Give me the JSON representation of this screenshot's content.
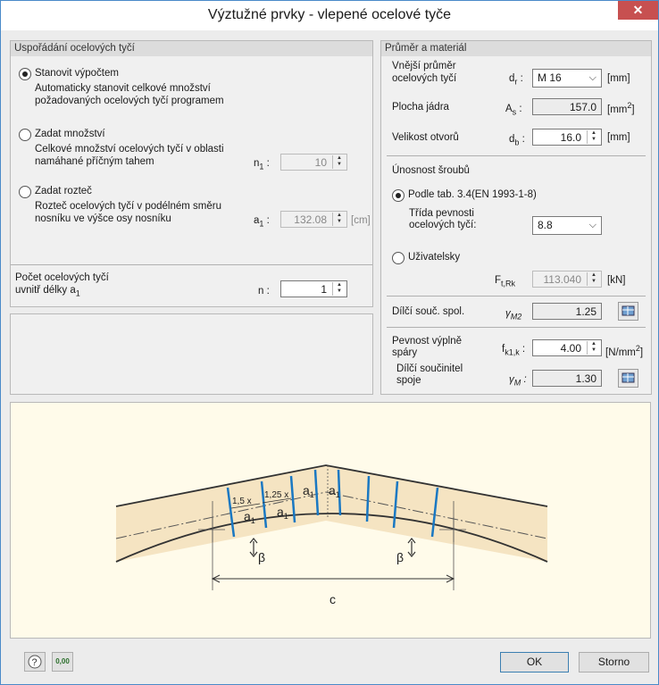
{
  "window": {
    "title": "Výztužné prvky - vlepené ocelové tyče",
    "close": "✕"
  },
  "arrangement": {
    "title": "Uspořádání ocelových tyčí",
    "opt1": {
      "label": "Stanovit výpočtem",
      "desc1": "Automaticky stanovit celkové množství",
      "desc2": "požadovaných ocelových tyčí programem",
      "selected": true
    },
    "opt2": {
      "label": "Zadat množství",
      "desc1": "Celkové množství ocelových tyčí v oblasti",
      "desc2": "namáhané příčným tahem",
      "sym": "n",
      "sym_sub": "1",
      "value": "10",
      "selected": false
    },
    "opt3": {
      "label": "Zadat rozteč",
      "desc1": "Rozteč ocelových tyčí v podélném směru",
      "desc2": "nosníku ve výšce osy nosníku",
      "sym": "a",
      "sym_sub": "1",
      "value": "132.08",
      "unit": "[cm]",
      "selected": false
    },
    "count": {
      "label1": "Počet ocelových tyčí",
      "label2": "uvnitř délky a",
      "label2_sub": "1",
      "sym": "n :",
      "value": "1"
    }
  },
  "material": {
    "title": "Průměr a materiál",
    "diameter": {
      "label1": "Vnější průměr",
      "label2": "ocelových tyčí",
      "sym": "d",
      "sym_sub": "r",
      "value": "M 16",
      "unit": "[mm]"
    },
    "core": {
      "label": "Plocha jádra",
      "sym": "A",
      "sym_sub": "s",
      "value": "157.0",
      "unit": "[mm",
      "unit_sup": "2",
      "unit_end": "]"
    },
    "hole": {
      "label": "Velikost otvorů",
      "sym": "d",
      "sym_sub": "b",
      "value": "16.0",
      "unit": "[mm]"
    },
    "bolt": {
      "title": "Únosnost šroubů",
      "opt1": {
        "label": "Podle tab. 3.4(EN 1993-1-8)",
        "selected": true
      },
      "class_label1": "Třída pevnosti",
      "class_label2": "ocelových tyčí:",
      "class_value": "8.8",
      "opt2": {
        "label": "Uživatelsky",
        "selected": false
      },
      "ftrk": {
        "sym": "F",
        "sym_sub": "t,Rk",
        "value": "113.040",
        "unit": "[kN]"
      }
    },
    "partial": {
      "label": "Dílčí souč. spol.",
      "sym": "γ",
      "sym_sub": "M2",
      "value": "1.25"
    },
    "strength": {
      "label1": "Pevnost výplně",
      "label2": "spáry",
      "sym": "f",
      "sym_sub": "k1,k",
      "value": "4.00",
      "unit": "[N/mm",
      "unit_sup": "2",
      "unit_end": "]"
    },
    "joint": {
      "label1": "Dílčí součinitel",
      "label2": "spoje",
      "sym": "γ",
      "sym_sub": "M",
      "value": "1.30"
    }
  },
  "diagram": {
    "l15": "1,5 x",
    "l125": "1,25 x",
    "a": "a",
    "sub1": "1",
    "beta": "β",
    "c": "c"
  },
  "footer": {
    "calc_label": "0,00",
    "ok": "OK",
    "cancel": "Storno"
  }
}
